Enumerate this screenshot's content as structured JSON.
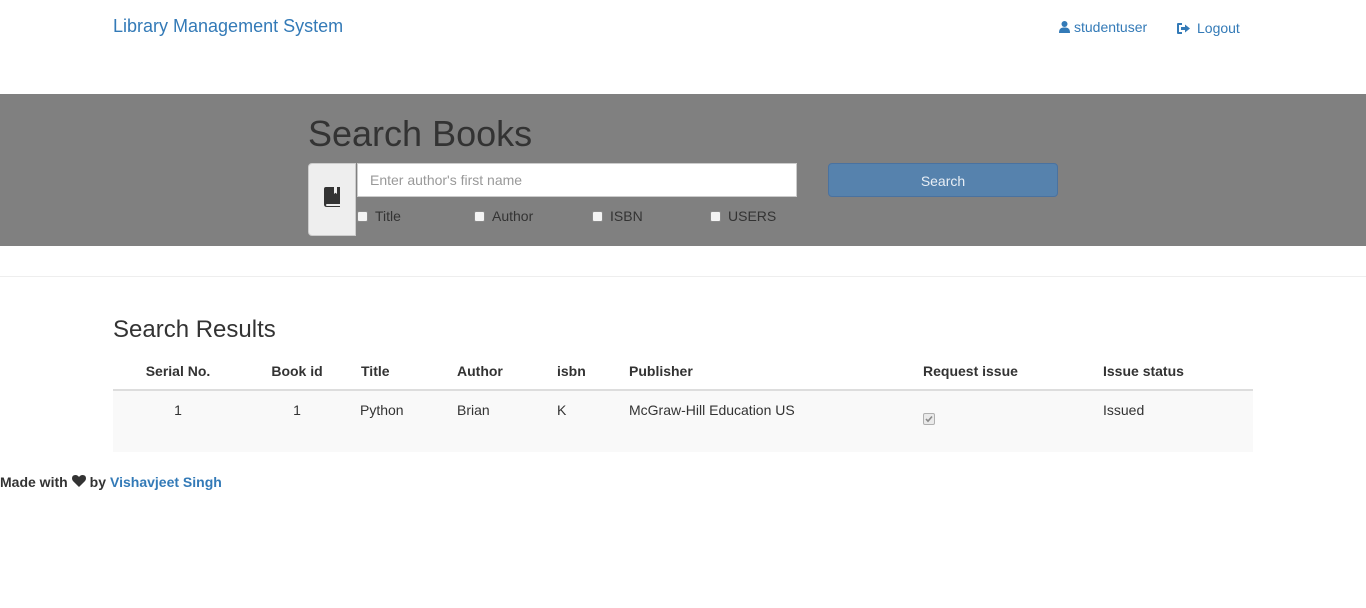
{
  "navbar": {
    "brand": "Library Management System",
    "user_label": "studentuser",
    "logout_label": "Logout",
    "user_icon": "user-icon",
    "logout_icon": "sign-out-icon"
  },
  "search": {
    "title": "Search Books",
    "addon_icon": "book-icon",
    "placeholder": "Enter author's first name",
    "button_label": "Search",
    "filters": [
      {
        "label": "Title",
        "checked": false
      },
      {
        "label": "Author",
        "checked": false
      },
      {
        "label": "ISBN",
        "checked": false
      },
      {
        "label": "USERS",
        "checked": false
      }
    ]
  },
  "results": {
    "title": "Search Results",
    "columns": [
      "Serial No.",
      "Book id",
      "Title",
      "Author",
      "isbn",
      "Publisher",
      "Request issue",
      "Issue status"
    ],
    "rows": [
      {
        "serial": "1",
        "book_id": "1",
        "title": "Python",
        "author": "Brian",
        "isbn": "K",
        "publisher": "McGraw-Hill Education US",
        "request_issue": true,
        "issue_status": "Issued"
      }
    ]
  },
  "footer": {
    "made_with": "Made with",
    "by": "by",
    "author_link": "Vishavjeet Singh",
    "heart_icon": "heart-icon"
  },
  "colors": {
    "link": "#337ab7",
    "jumbotron_bg": "#808080",
    "search_button": "#5682ad"
  }
}
